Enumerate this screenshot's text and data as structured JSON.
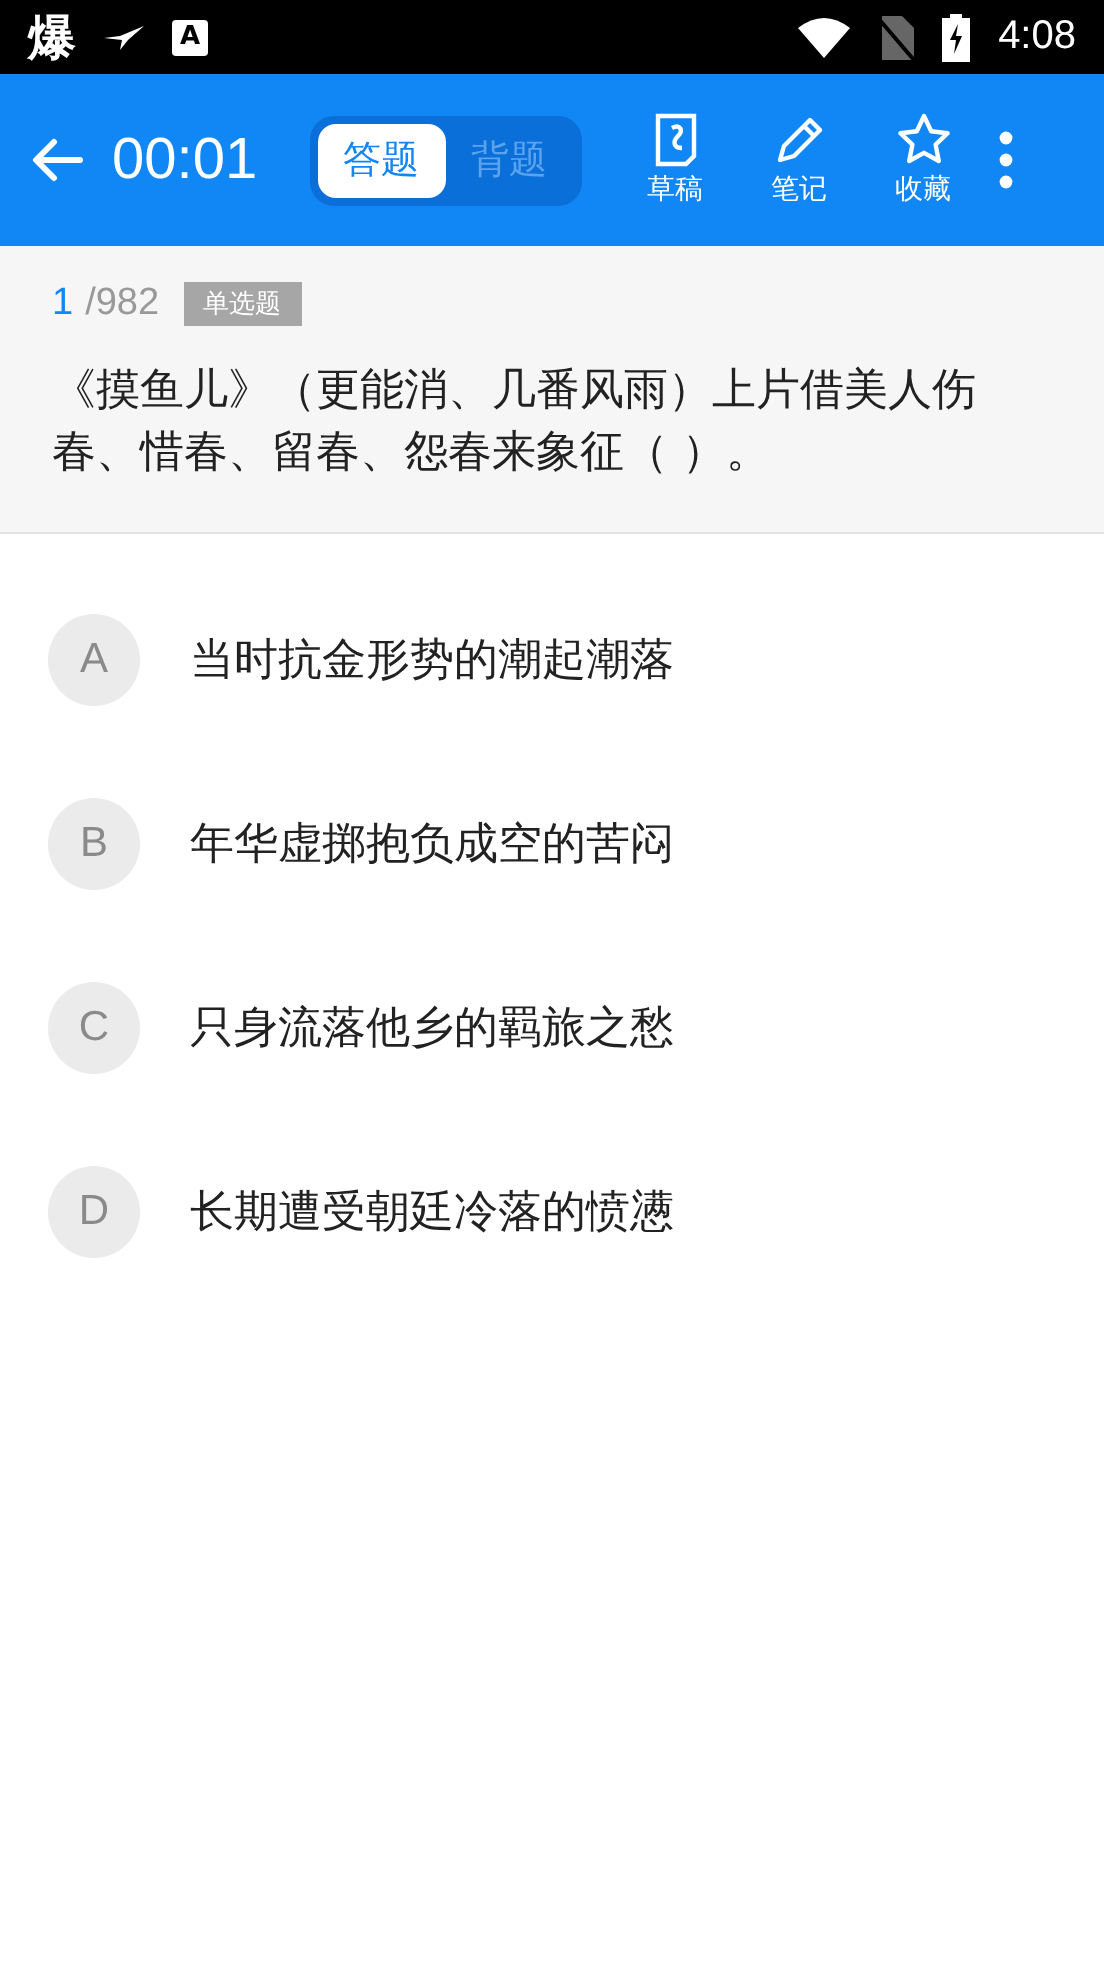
{
  "status_bar": {
    "app_glyph": "爆",
    "app_badge": "A",
    "time": "4:08"
  },
  "toolbar": {
    "timer": "00:01",
    "tabs": [
      {
        "label": "答题",
        "selected": true
      },
      {
        "label": "背题",
        "selected": false
      }
    ],
    "actions": [
      {
        "kind": "draft",
        "label": "草稿"
      },
      {
        "kind": "note",
        "label": "笔记"
      },
      {
        "kind": "star",
        "label": "收藏"
      }
    ]
  },
  "question": {
    "index": "1",
    "total": "/982",
    "type": "单选题",
    "text": "《摸鱼儿》（更能消、几番风雨）上片借美人伤春、惜春、留春、怨春来象征（ ）。"
  },
  "options": [
    {
      "letter": "A",
      "text": "当时抗金形势的潮起潮落",
      "selected": false
    },
    {
      "letter": "B",
      "text": "年华虚掷抱负成空的苦闷",
      "selected": false
    },
    {
      "letter": "C",
      "text": "只身流落他乡的羁旅之愁",
      "selected": false
    },
    {
      "letter": "D",
      "text": "长期遭受朝廷冷落的愤懑",
      "selected": false
    }
  ]
}
